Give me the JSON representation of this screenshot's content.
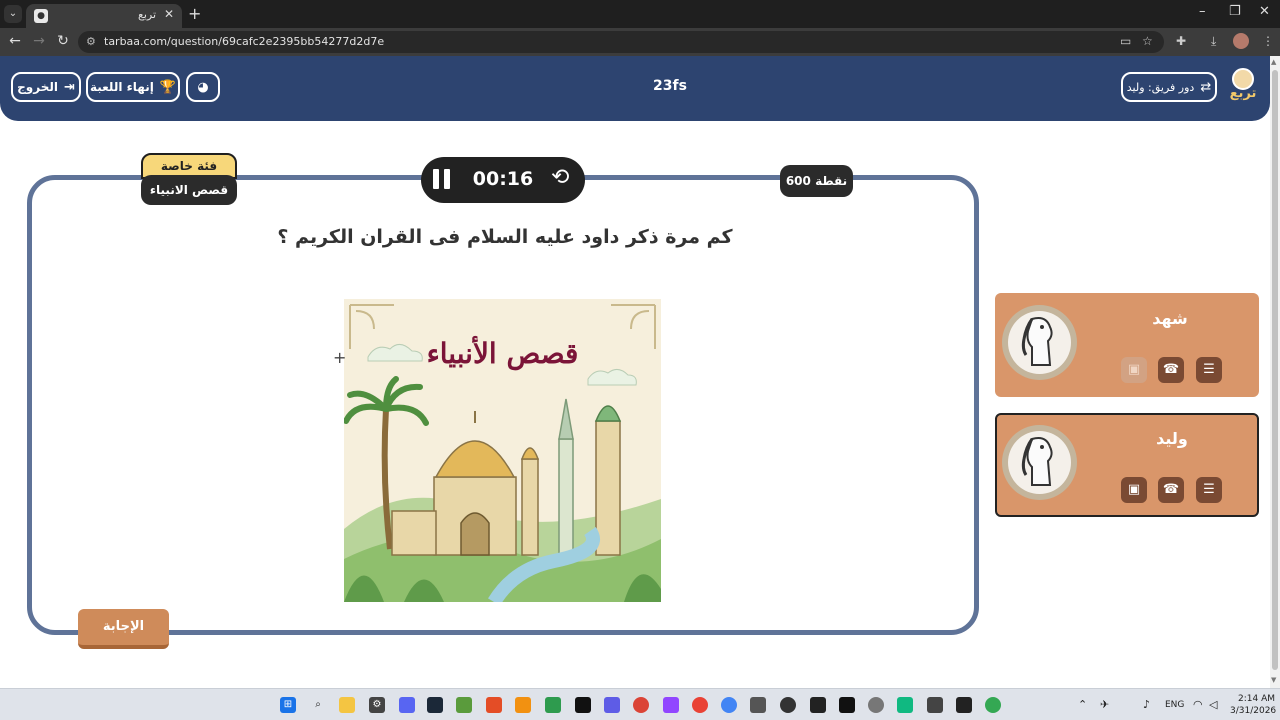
{
  "browser": {
    "tab_title": "تربع",
    "tab_close": "✕",
    "new_tab": "+",
    "url": "tarbaa.com/question/69cafc2e2395bb54277d2d7e",
    "win_min": "–",
    "win_max": "❐",
    "win_close": "✕"
  },
  "header": {
    "exit_label": "الخروج",
    "end_game_label": "إنهاء اللعبة",
    "game_title": "23fs",
    "team_turn_label": "دور فريق: وليد",
    "logo_text": "تربع"
  },
  "question": {
    "category_top": "فئة خاصة",
    "category_name": "قصص الانبياء",
    "timer": "00:16",
    "points": "600 نقطة",
    "text": "كم مرة ذكر داود عليه السلام فى القران الكريم ؟",
    "image_title": "قصص الأنبياء",
    "answer_label": "الإجابة"
  },
  "teams": [
    {
      "name": "شهد"
    },
    {
      "name": "وليد"
    }
  ],
  "taskbar": {
    "lang": "ENG",
    "time": "2:14 AM",
    "date": "3/31/2026"
  },
  "colors": {
    "header_bg": "#2d4470",
    "card_border": "#5f7398",
    "team_card": "#d9966a",
    "answer_button": "#cf8b5a",
    "image_title": "#7b1438"
  }
}
